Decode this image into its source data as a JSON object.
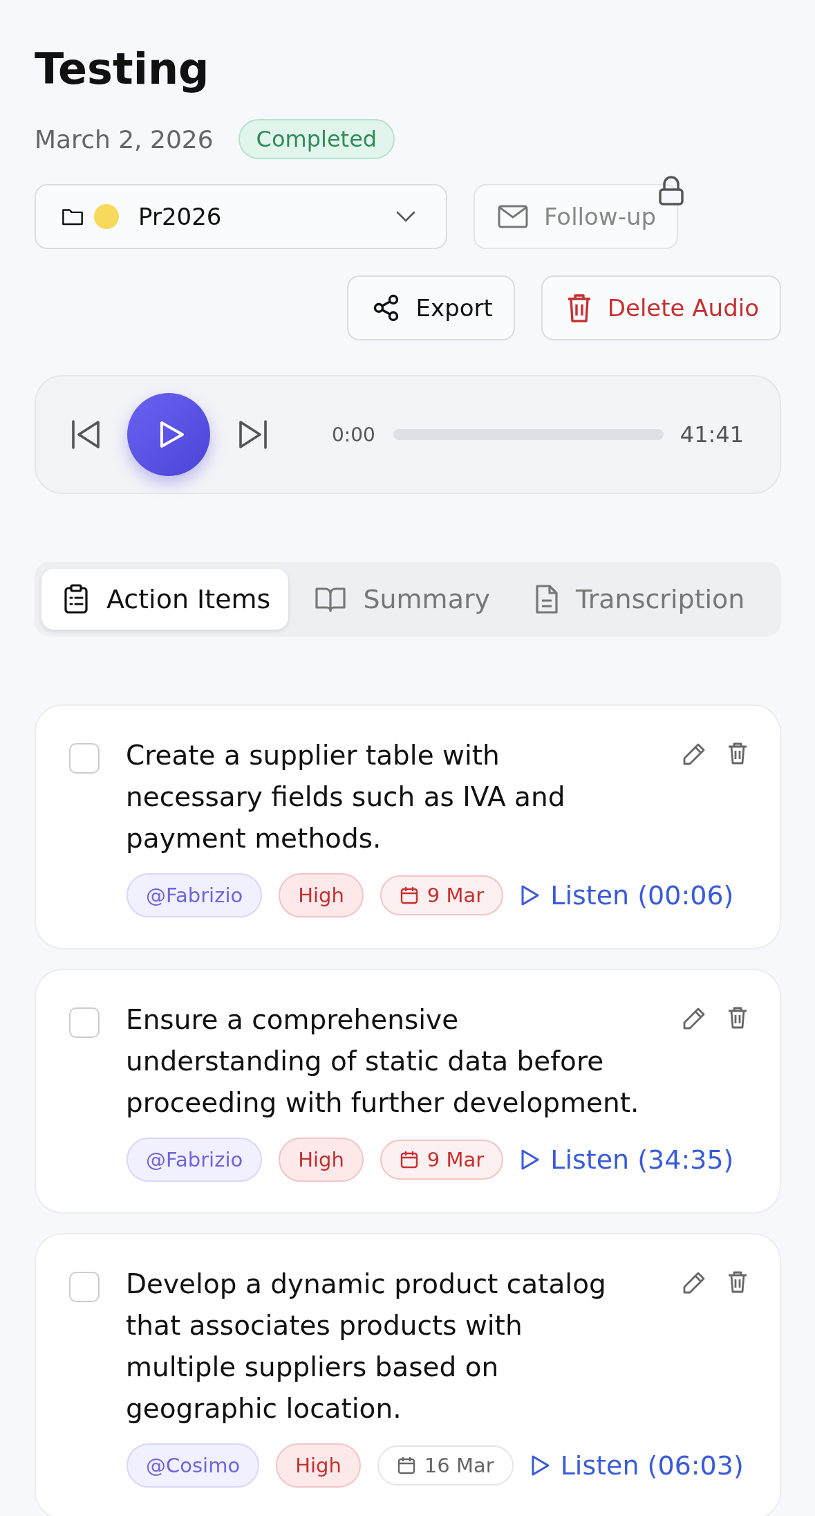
{
  "title": "Testing",
  "date": "March 2, 2026",
  "status": {
    "label": "Completed",
    "kind": "completed"
  },
  "folder": {
    "name": "Pr2026",
    "color": "#f7d95c"
  },
  "follow_up": {
    "label": "Follow-up",
    "locked": true
  },
  "actions": [
    {
      "label": "Export",
      "kind": "export"
    },
    {
      "label": "Delete Audio",
      "kind": "delete"
    }
  ],
  "player": {
    "current": "0:00",
    "total": "41:41"
  },
  "tabs": [
    {
      "label": "Action Items",
      "kind": "items",
      "selected": true
    },
    {
      "label": "Summary",
      "kind": "summary",
      "selected": false
    },
    {
      "label": "Transcription",
      "kind": "transcript",
      "selected": false
    }
  ],
  "items": [
    {
      "text": "Create a supplier table with necessary fields such as IVA and payment methods.",
      "checked": false,
      "assignee": "@Fabrizio",
      "priority": "High",
      "due": "9 Mar",
      "overdue": true,
      "listen": "Listen (00:06)"
    },
    {
      "text": "Ensure a comprehensive understanding of static data before proceeding with further development.",
      "checked": false,
      "assignee": "@Fabrizio",
      "priority": "High",
      "due": "9 Mar",
      "overdue": true,
      "listen": "Listen (34:35)"
    },
    {
      "text": "Develop a dynamic product catalog that associates products with multiple suppliers based on geographic location.",
      "checked": false,
      "assignee": "@Cosimo",
      "priority": "High",
      "due": "16 Mar",
      "overdue": false,
      "listen": "Listen (06:03)"
    }
  ]
}
